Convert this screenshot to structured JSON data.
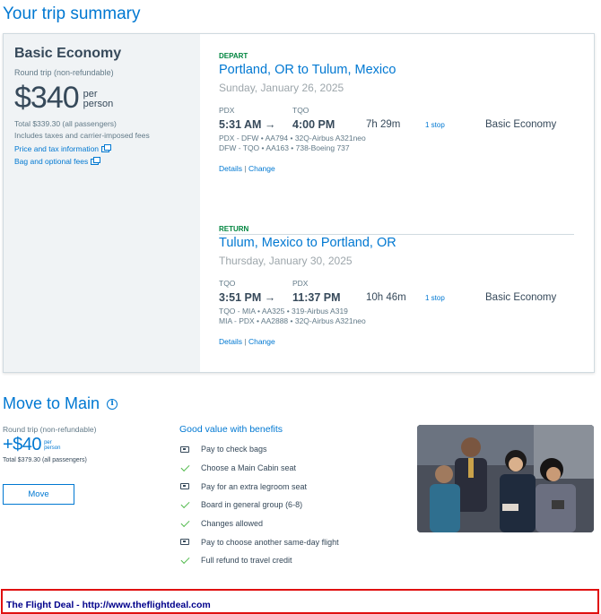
{
  "page": {
    "title": "Your trip summary"
  },
  "fare": {
    "name": "Basic Economy",
    "subtitle": "Round trip (non-refundable)",
    "price": "$340",
    "per_line1": "per",
    "per_line2": "person",
    "total": "Total $339.30 (all passengers)",
    "fees_note": "Includes taxes and carrier-imposed fees",
    "price_tax_link": "Price and tax information",
    "bag_fees_link": "Bag and optional fees",
    "link_icon": "external-window-icon"
  },
  "depart": {
    "label": "DEPART",
    "route": "Portland, OR to Tulum, Mexico",
    "date": "Sunday, January 26, 2025",
    "origin_code": "PDX",
    "dest_code": "TQO",
    "dep_time": "5:31 AM →",
    "arr_time": "4:00 PM",
    "duration": "7h 29m",
    "stops": "1 stop",
    "cabin": "Basic Economy",
    "leg1": "PDX - DFW • AA794 • 32Q-Airbus A321neo",
    "leg2": "DFW - TQO • AA163 • 738-Boeing 737",
    "details": "Details",
    "separator": "|",
    "change": "Change"
  },
  "return": {
    "label": "RETURN",
    "route": "Tulum, Mexico to Portland, OR",
    "date": "Thursday, January 30, 2025",
    "origin_code": "TQO",
    "dest_code": "PDX",
    "dep_time": "3:51 PM →",
    "arr_time": "11:37 PM",
    "duration": "10h 46m",
    "stops": "1 stop",
    "cabin": "Basic Economy",
    "leg1": "TQO - MIA • AA325 • 319-Airbus A319",
    "leg2": "MIA - PDX • AA2888 • 32Q-Airbus A321neo",
    "details": "Details",
    "separator": "|",
    "change": "Change"
  },
  "move_to_main": {
    "title": "Move to Main",
    "info_icon": "i",
    "subtitle": "Round trip (non-refundable)",
    "price": "+$40",
    "per_line1": "per",
    "per_line2": "person",
    "total": "Total $379.30 (all passengers)",
    "button": "Move",
    "benefits_title": "Good value with benefits",
    "benefits": [
      {
        "icon": "bag-icon",
        "text": "Pay to check bags"
      },
      {
        "icon": "check-icon",
        "text": "Choose a Main Cabin seat"
      },
      {
        "icon": "bag-icon",
        "text": "Pay for an extra legroom seat"
      },
      {
        "icon": "check-icon",
        "text": "Board in general group (6-8)"
      },
      {
        "icon": "check-icon",
        "text": "Changes allowed"
      },
      {
        "icon": "bag-icon",
        "text": "Pay to choose another same-day flight"
      },
      {
        "icon": "check-icon",
        "text": "Full refund to travel credit"
      }
    ]
  },
  "footer": {
    "text": "The Flight Deal - http://www.theflightdeal.com"
  },
  "colors": {
    "brand_blue": "#0078d2",
    "depart_green": "#00853f",
    "check_green": "#4db848",
    "banner_red": "#e01010",
    "banner_text": "#00008b"
  }
}
